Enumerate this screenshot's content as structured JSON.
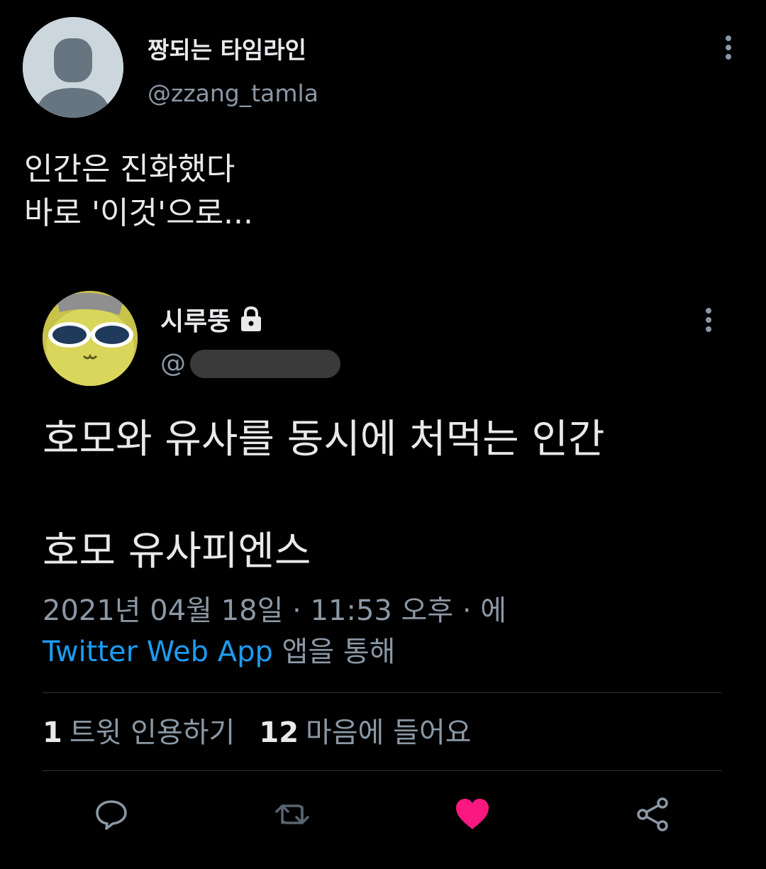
{
  "outer_tweet": {
    "display_name": "짱되는 타임라인",
    "handle": "@zzang_tamla",
    "text": "인간은 진화했다\n바로 '이것'으로..."
  },
  "quoted_tweet": {
    "display_name": "시루뚱",
    "handle_prefix": "@",
    "text_line_1": "호모와 유사를 동시에 처먹는 인간",
    "text_line_2": "호모 유사피엔스",
    "timestamp": "2021년 04월 18일 · 11:53 오후 · 에",
    "source_app": "Twitter Web App",
    "source_suffix": " 앱을 통해",
    "stats": {
      "quote_count": "1",
      "quote_label": "트윗 인용하기",
      "like_count": "12",
      "like_label": "마음에 들어요"
    }
  },
  "colors": {
    "background": "#000000",
    "link": "#1d9bf0",
    "secondary_text": "#8b98a5",
    "like_active": "#f91880"
  },
  "icons": [
    "more-icon",
    "lock-icon",
    "reply-icon",
    "retweet-icon",
    "heart-icon",
    "share-icon"
  ]
}
